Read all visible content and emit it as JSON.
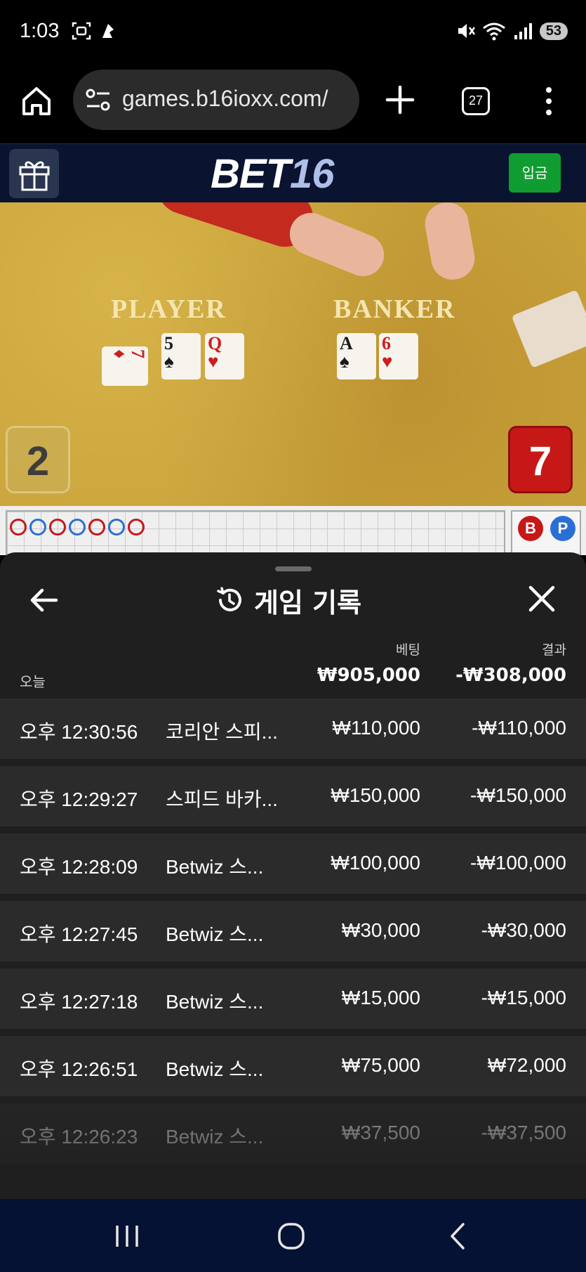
{
  "status_bar": {
    "time": "1:03",
    "battery": "53",
    "icons": [
      "screenshot-icon",
      "app-notification-icon",
      "mute-icon",
      "wifi-icon",
      "signal-icon"
    ]
  },
  "browser": {
    "url": "games.b16ioxx.com/",
    "tab_count": "27"
  },
  "site": {
    "logo_part1": "BET",
    "logo_part2": "16",
    "deposit_label": "입금"
  },
  "game": {
    "player_label": "PLAYER",
    "banker_label": "BANKER",
    "player_cards": [
      {
        "rank": "7",
        "suit": "♦",
        "color": "red"
      },
      {
        "rank": "5",
        "suit": "♠",
        "color": "black"
      },
      {
        "rank": "Q",
        "suit": "♥",
        "color": "red"
      }
    ],
    "banker_cards": [
      {
        "rank": "A",
        "suit": "♠",
        "color": "black"
      },
      {
        "rank": "6",
        "suit": "♥",
        "color": "red"
      }
    ],
    "player_score": "2",
    "banker_score": "7",
    "roadmap_b": "B",
    "roadmap_p": "P"
  },
  "history": {
    "title": "게임 기록",
    "col_bet": "베팅",
    "col_result": "결과",
    "today_label": "오늘",
    "total_bet": "₩905,000",
    "total_result": "-₩308,000",
    "rows": [
      {
        "time": "오후 12:30:56",
        "game": "코리안 스피...",
        "bet": "₩110,000",
        "result": "-₩110,000"
      },
      {
        "time": "오후 12:29:27",
        "game": "스피드 바카...",
        "bet": "₩150,000",
        "result": "-₩150,000"
      },
      {
        "time": "오후 12:28:09",
        "game": "Betwiz 스...",
        "bet": "₩100,000",
        "result": "-₩100,000"
      },
      {
        "time": "오후 12:27:45",
        "game": "Betwiz 스...",
        "bet": "₩30,000",
        "result": "-₩30,000"
      },
      {
        "time": "오후 12:27:18",
        "game": "Betwiz 스...",
        "bet": "₩15,000",
        "result": "-₩15,000"
      },
      {
        "time": "오후 12:26:51",
        "game": "Betwiz 스...",
        "bet": "₩75,000",
        "result": "₩72,000"
      },
      {
        "time": "오후 12:26:23",
        "game": "Betwiz 스...",
        "bet": "₩37,500",
        "result": "-₩37,500"
      }
    ]
  },
  "colors": {
    "deposit_green": "#119c32",
    "banker_red": "#c71818",
    "player_blue": "#2a6fd6",
    "header_navy": "#0a1430"
  }
}
